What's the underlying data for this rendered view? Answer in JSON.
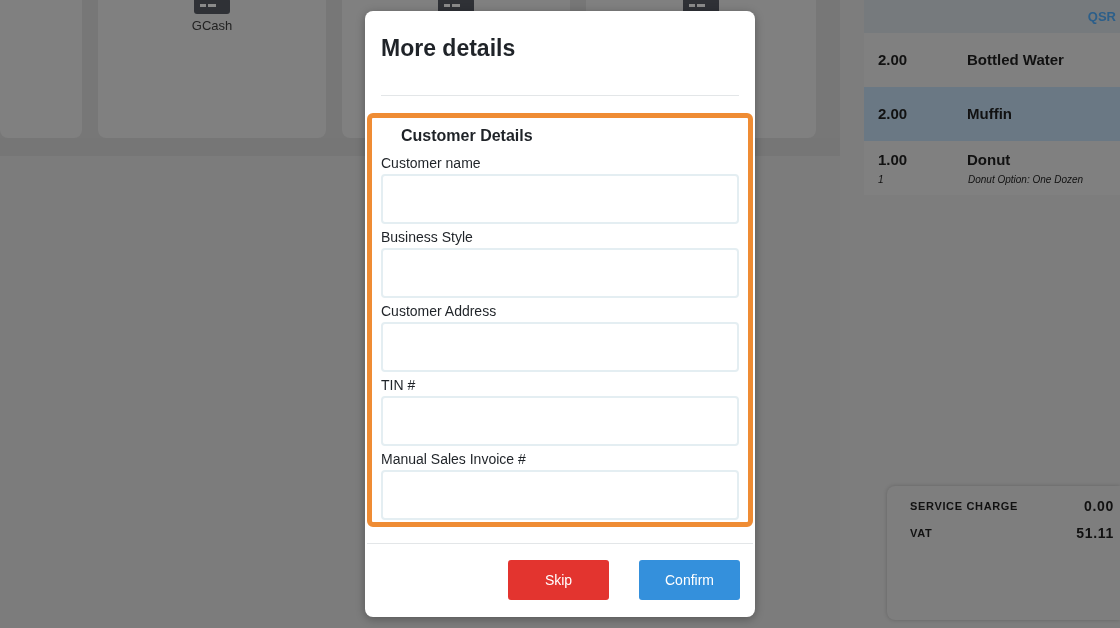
{
  "background": {
    "cards": [
      {
        "kind": "blank"
      },
      {
        "kind": "icon",
        "label": "GCash"
      },
      {
        "kind": "icon"
      },
      {
        "kind": "icon"
      }
    ],
    "order": {
      "header": "QSR",
      "items": [
        {
          "qty": "2.00",
          "name": "Bottled Water",
          "selected": false
        },
        {
          "qty": "2.00",
          "name": "Muffin",
          "selected": true
        },
        {
          "qty": "1.00",
          "name": "Donut",
          "selected": false,
          "sub_qty": "1",
          "note": "Donut Option: One Dozen"
        }
      ]
    },
    "totals": [
      {
        "label": "SERVICE CHARGE",
        "value": "0.00"
      },
      {
        "label": "VAT",
        "value": "51.11"
      }
    ]
  },
  "modal": {
    "title": "More details",
    "section": {
      "title": "Customer Details",
      "highlighted": true,
      "fields": [
        {
          "label": "Customer name"
        },
        {
          "label": "Business Style"
        },
        {
          "label": "Customer Address"
        },
        {
          "label": "TIN #"
        },
        {
          "label": "Manual Sales Invoice #"
        }
      ]
    },
    "buttons": [
      {
        "label": "Skip",
        "kind": "danger"
      },
      {
        "label": "Confirm",
        "kind": "primary"
      }
    ]
  }
}
